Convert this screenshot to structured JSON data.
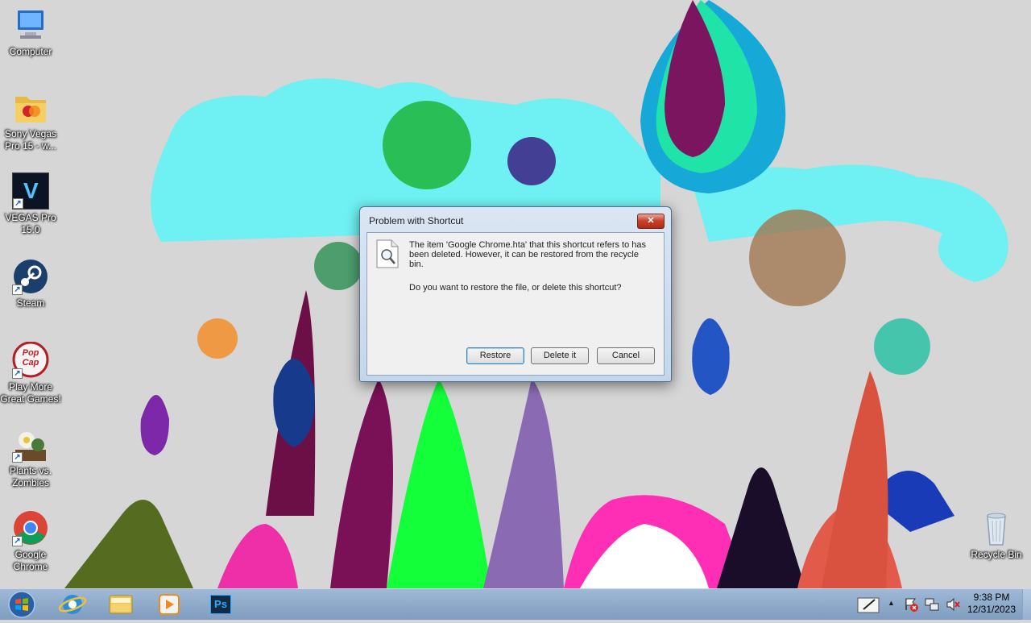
{
  "desktop": {
    "icons": [
      {
        "name": "computer",
        "label": "Computer"
      },
      {
        "name": "sony-vegas",
        "label": "Sony Vegas\nPro 15 - w..."
      },
      {
        "name": "vegas-pro",
        "label": "VEGAS Pro\n15.0",
        "glyph": "V"
      },
      {
        "name": "steam",
        "label": "Steam"
      },
      {
        "name": "popcap",
        "label": "Play More\nGreat Games!",
        "glyph": "Pop\nCap"
      },
      {
        "name": "plants-vs-zombies",
        "label": "Plants vs.\nZombies"
      },
      {
        "name": "google-chrome",
        "label": "Google\nChrome"
      },
      {
        "name": "recycle-bin",
        "label": "Recycle Bin"
      }
    ]
  },
  "dialog": {
    "title": "Problem with Shortcut",
    "close_glyph": "✕",
    "message": "The item 'Google Chrome.hta' that this shortcut refers to has been deleted.  However, it can be restored from the recycle bin.",
    "question": "Do you want to restore the file, or delete this shortcut?",
    "buttons": {
      "restore": "Restore",
      "delete": "Delete it",
      "cancel": "Cancel"
    }
  },
  "taskbar": {
    "pinned": [
      "internet-explorer-icon",
      "windows-explorer-icon",
      "media-player-icon",
      "photoshop-icon"
    ],
    "photoshop_glyph": "Ps",
    "tray_icons": [
      "pen-input-icon",
      "show-hidden-icons-icon",
      "action-center-icon",
      "network-icon",
      "volume-muted-icon"
    ],
    "clock": {
      "time": "9:38 PM",
      "date": "12/31/2023"
    }
  },
  "colors": {
    "taskbar": "#8fabcc",
    "dialog_frame": "#c4d6ea",
    "wallpaper_bg": "#d6d6d6"
  }
}
